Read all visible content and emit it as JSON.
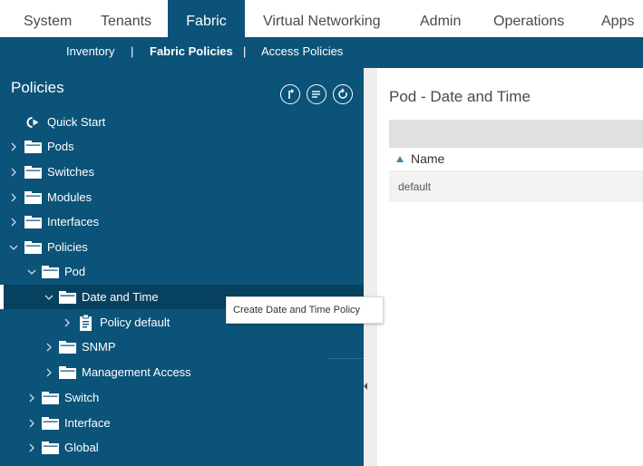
{
  "topnav": {
    "tabs": [
      {
        "label": "System"
      },
      {
        "label": "Tenants"
      },
      {
        "label": "Fabric",
        "active": true
      },
      {
        "label": "Virtual Networking"
      },
      {
        "label": "Admin"
      },
      {
        "label": "Operations"
      },
      {
        "label": "Apps"
      }
    ]
  },
  "subnav": {
    "items": [
      {
        "label": "Inventory"
      },
      {
        "label": "Fabric Policies",
        "active": true
      },
      {
        "label": "Access Policies"
      }
    ],
    "separator": "|"
  },
  "left_pane": {
    "title": "Policies",
    "tools": [
      {
        "icon": "add-icon"
      },
      {
        "icon": "list-icon"
      },
      {
        "icon": "refresh-icon"
      }
    ],
    "tree": [
      {
        "label": "Quick Start",
        "icon": "quick-start-icon"
      },
      {
        "label": "Pods",
        "icon": "folder-icon",
        "expanded": false
      },
      {
        "label": "Switches",
        "icon": "folder-icon",
        "expanded": false
      },
      {
        "label": "Modules",
        "icon": "folder-icon",
        "expanded": false
      },
      {
        "label": "Interfaces",
        "icon": "folder-icon",
        "expanded": false
      },
      {
        "label": "Policies",
        "icon": "folder-icon",
        "expanded": true
      },
      {
        "label": "Pod",
        "icon": "folder-icon",
        "expanded": true
      },
      {
        "label": "Date and Time",
        "icon": "folder-icon",
        "expanded": true,
        "selected": true
      },
      {
        "label": "Policy default",
        "icon": "policy-document-icon",
        "expanded": false
      },
      {
        "label": "SNMP",
        "icon": "folder-icon",
        "expanded": false
      },
      {
        "label": "Management Access",
        "icon": "folder-icon",
        "expanded": false
      },
      {
        "label": "Switch",
        "icon": "folder-icon",
        "expanded": false
      },
      {
        "label": "Interface",
        "icon": "folder-icon",
        "expanded": false
      },
      {
        "label": "Global",
        "icon": "folder-icon",
        "expanded": false
      }
    ]
  },
  "right_pane": {
    "title": "Pod - Date and Time",
    "table": {
      "columns": [
        {
          "label": "Name",
          "sort": "ascending"
        }
      ],
      "rows": [
        [
          "default"
        ]
      ]
    }
  },
  "tooltip": {
    "text": "Create Date and Time Policy"
  },
  "colors": {
    "nav_blue": "#0b5378",
    "selected_row": "#06415f",
    "text_white": "#ffffff",
    "table_bar": "#e0e0e0"
  }
}
